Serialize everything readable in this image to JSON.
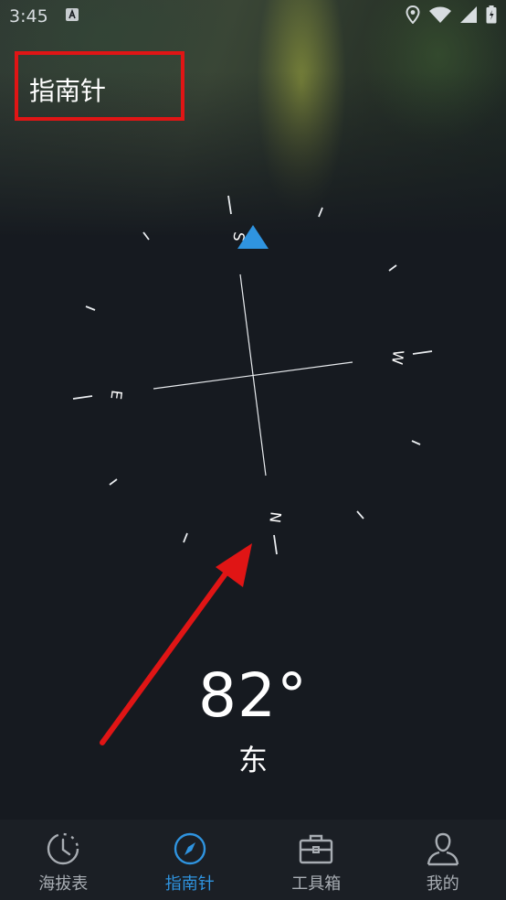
{
  "status_bar": {
    "time": "3:45"
  },
  "header": {
    "title": "指南针"
  },
  "compass": {
    "cardinal_labels": {
      "north": "N",
      "south": "S",
      "east": "E",
      "west": "W"
    },
    "degrees_text": "82°",
    "direction_text": "东",
    "accent_color": "#2f94e0"
  },
  "tabs": [
    {
      "label": "海拔表",
      "icon": "altimeter-icon",
      "active": false
    },
    {
      "label": "指南针",
      "icon": "compass-icon",
      "active": true
    },
    {
      "label": "工具箱",
      "icon": "toolbox-icon",
      "active": false
    },
    {
      "label": "我的",
      "icon": "profile-icon",
      "active": false
    }
  ],
  "annotations": {
    "highlight_color": "#e01515"
  }
}
